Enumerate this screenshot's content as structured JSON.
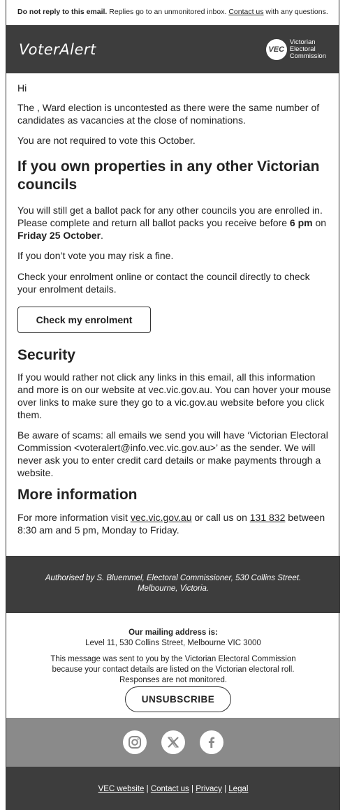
{
  "notice": {
    "bold": "Do not reply to this email.",
    "text": " Replies go to an unmonitored inbox. ",
    "link": "Contact us",
    "tail": " with any questions."
  },
  "header": {
    "brand": "VoterAlert",
    "logo_mark": "VEC",
    "logo_line1": "Victorian",
    "logo_line2": "Electoral",
    "logo_line3": "Commission"
  },
  "body": {
    "greeting": "Hi",
    "para1": "The , Ward election is uncontested as there were the same number of candidates as vacancies at the close of nominations.",
    "para2": "You are not required to vote this October.",
    "heading1": "If you own properties in any other Victorian councils",
    "para3_a": "You will still get a ballot pack for any other councils you are enrolled in. Please complete and return all ballot packs you receive before ",
    "para3_b": "6 pm",
    "para3_c": " on ",
    "para3_d": "Friday 25 October",
    "para3_e": ".",
    "para4": "If you don’t vote you may risk a fine.",
    "para5": "Check your enrolment online or contact the council directly to check your enrolment details.",
    "button": "Check my enrolment",
    "heading2": "Security",
    "para6": "If you would rather not click any links in this email, all this information and more is on our website at vec.vic.gov.au. You can hover your mouse over links to make sure they go to a vic.gov.au website before you click them.",
    "para7": "Be aware of scams: all emails we send you will have ‘Victorian Electoral Commission <voteralert@info.vec.vic.gov.au>’ as the sender. We will never ask you to enter credit card details or make payments through a website.",
    "heading3": "More information",
    "para8_a": "For more information visit ",
    "para8_link1": "vec.vic.gov.au",
    "para8_b": " or call us on ",
    "para8_link2": "131 832",
    "para8_c": " between 8:30 am and 5 pm, Monday to Friday."
  },
  "authorised": "Authorised by S. Bluemmel, Electoral Commissioner, 530 Collins Street. Melbourne, Victoria.",
  "footer": {
    "mailing_title": "Our mailing address is:",
    "mailing_address": "Level 11, 530 Collins Street, Melbourne VIC 3000",
    "message": "This message was sent to you by the Victorian Electoral Commission because your contact details are listed on the Victorian electoral roll. Responses are not monitored.",
    "unsubscribe": "UNSUBSCRIBE",
    "social_icons": [
      "instagram-icon",
      "x-icon",
      "facebook-icon"
    ],
    "links": [
      "VEC website",
      "Contact us",
      "Privacy",
      "Legal"
    ],
    "separator": " | "
  }
}
